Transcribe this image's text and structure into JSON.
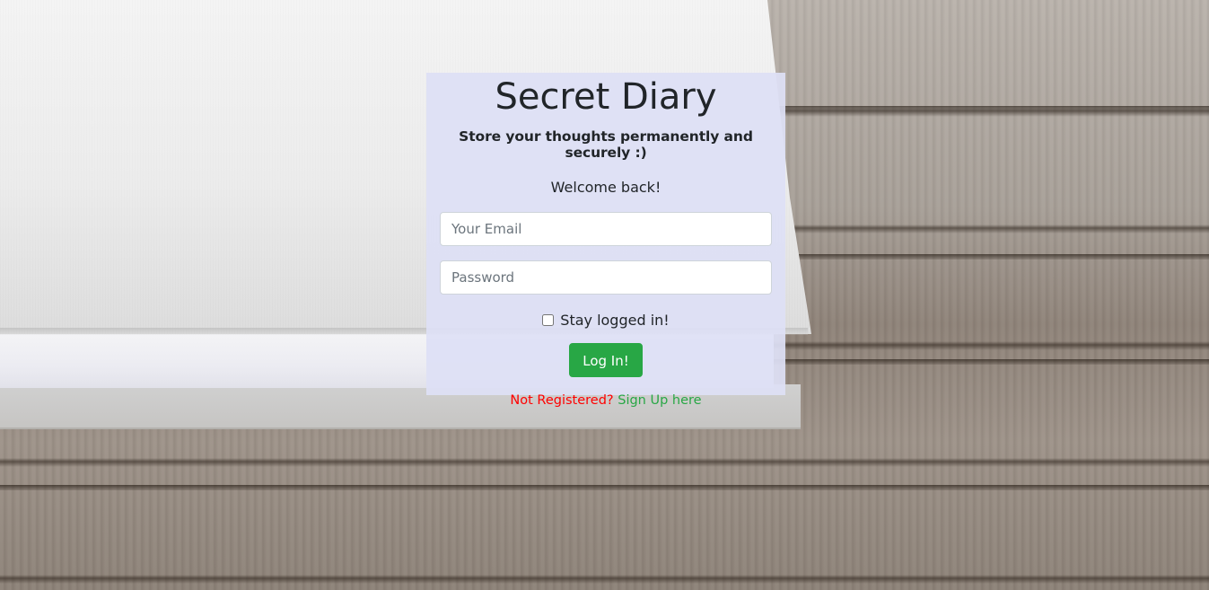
{
  "app": {
    "title": "Secret Diary",
    "subtitle": "Store your thoughts permanently and securely :)",
    "welcome": "Welcome back!"
  },
  "form": {
    "email": {
      "value": "",
      "placeholder": "Your Email"
    },
    "password": {
      "value": "",
      "placeholder": "Password"
    },
    "remember_label": "Stay logged in!",
    "remember_checked": false,
    "submit_label": "Log In!"
  },
  "footer": {
    "prompt": "Not Registered?",
    "link_label": "Sign Up here"
  },
  "colors": {
    "accent_green": "#28a745",
    "warning_red": "#ff0000",
    "panel_bg": "#dee0f5"
  }
}
